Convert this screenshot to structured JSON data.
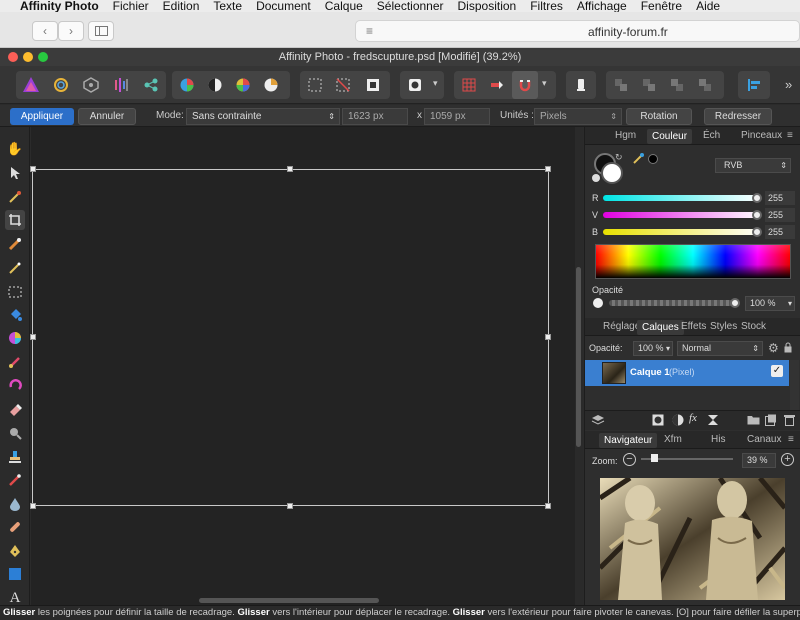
{
  "menubar": {
    "app": "Affinity Photo",
    "items": [
      "Fichier",
      "Edition",
      "Texte",
      "Document",
      "Calque",
      "Sélectionner",
      "Disposition",
      "Filtres",
      "Affichage",
      "Fenêtre",
      "Aide"
    ]
  },
  "browser": {
    "back": "‹",
    "forward": "›",
    "sidebar_icon": "sidebar-icon",
    "reader_icon": "≡",
    "url": "affinity-forum.fr"
  },
  "window": {
    "title": "Affinity Photo - fredscupture.psd [Modifié] (39.2%)"
  },
  "toolbar": {
    "more": "»"
  },
  "contextbar": {
    "apply": "Appliquer",
    "cancel": "Annuler",
    "mode_label": "Mode:",
    "mode_value": "Sans contrainte",
    "width": "1623 px",
    "x_label": "x",
    "height": "1059 px",
    "units_label": "Unités :",
    "units_value": "Pixels",
    "rotation": "Rotation",
    "straighten": "Redresser"
  },
  "color_panel": {
    "tabs": [
      "Hgm",
      "Couleur",
      "Éch",
      "Pinceaux"
    ],
    "active_tab": "Couleur",
    "model": "RVB",
    "r_label": "R",
    "r_value": "255",
    "v_label": "V",
    "v_value": "255",
    "b_label": "B",
    "b_value": "255",
    "opacity_label": "Opacité",
    "opacity_value": "100 %"
  },
  "layers_panel": {
    "tabs": [
      "Réglage",
      "Calques",
      "Effets",
      "Styles",
      "Stock"
    ],
    "active_tab": "Calques",
    "opacity_label": "Opacité:",
    "opacity_value": "100 %",
    "blend_mode": "Normal",
    "layer_name": "Calque 1",
    "layer_type": "(Pixel)"
  },
  "navigator_panel": {
    "tabs": [
      "Navigateur",
      "Xfm",
      "His",
      "Canaux"
    ],
    "active_tab": "Navigateur",
    "zoom_label": "Zoom:",
    "zoom_value": "39 %"
  },
  "status": {
    "s1_bold": "Glisser",
    "s1": " les poignées pour définir la taille de recadrage. ",
    "s2_bold": "Glisser",
    "s2": " vers l'intérieur pour déplacer le recadrage. ",
    "s3_bold": "Glisser",
    "s3": " vers l'extérieur pour faire pivoter le canevas. [O] pour faire défiler la superposition. ",
    "s4_bold": "⇧"
  },
  "colors": {
    "accent": "#2c6fc9",
    "selected_layer": "#3a7fd0",
    "canvas_bg": "#232323"
  }
}
